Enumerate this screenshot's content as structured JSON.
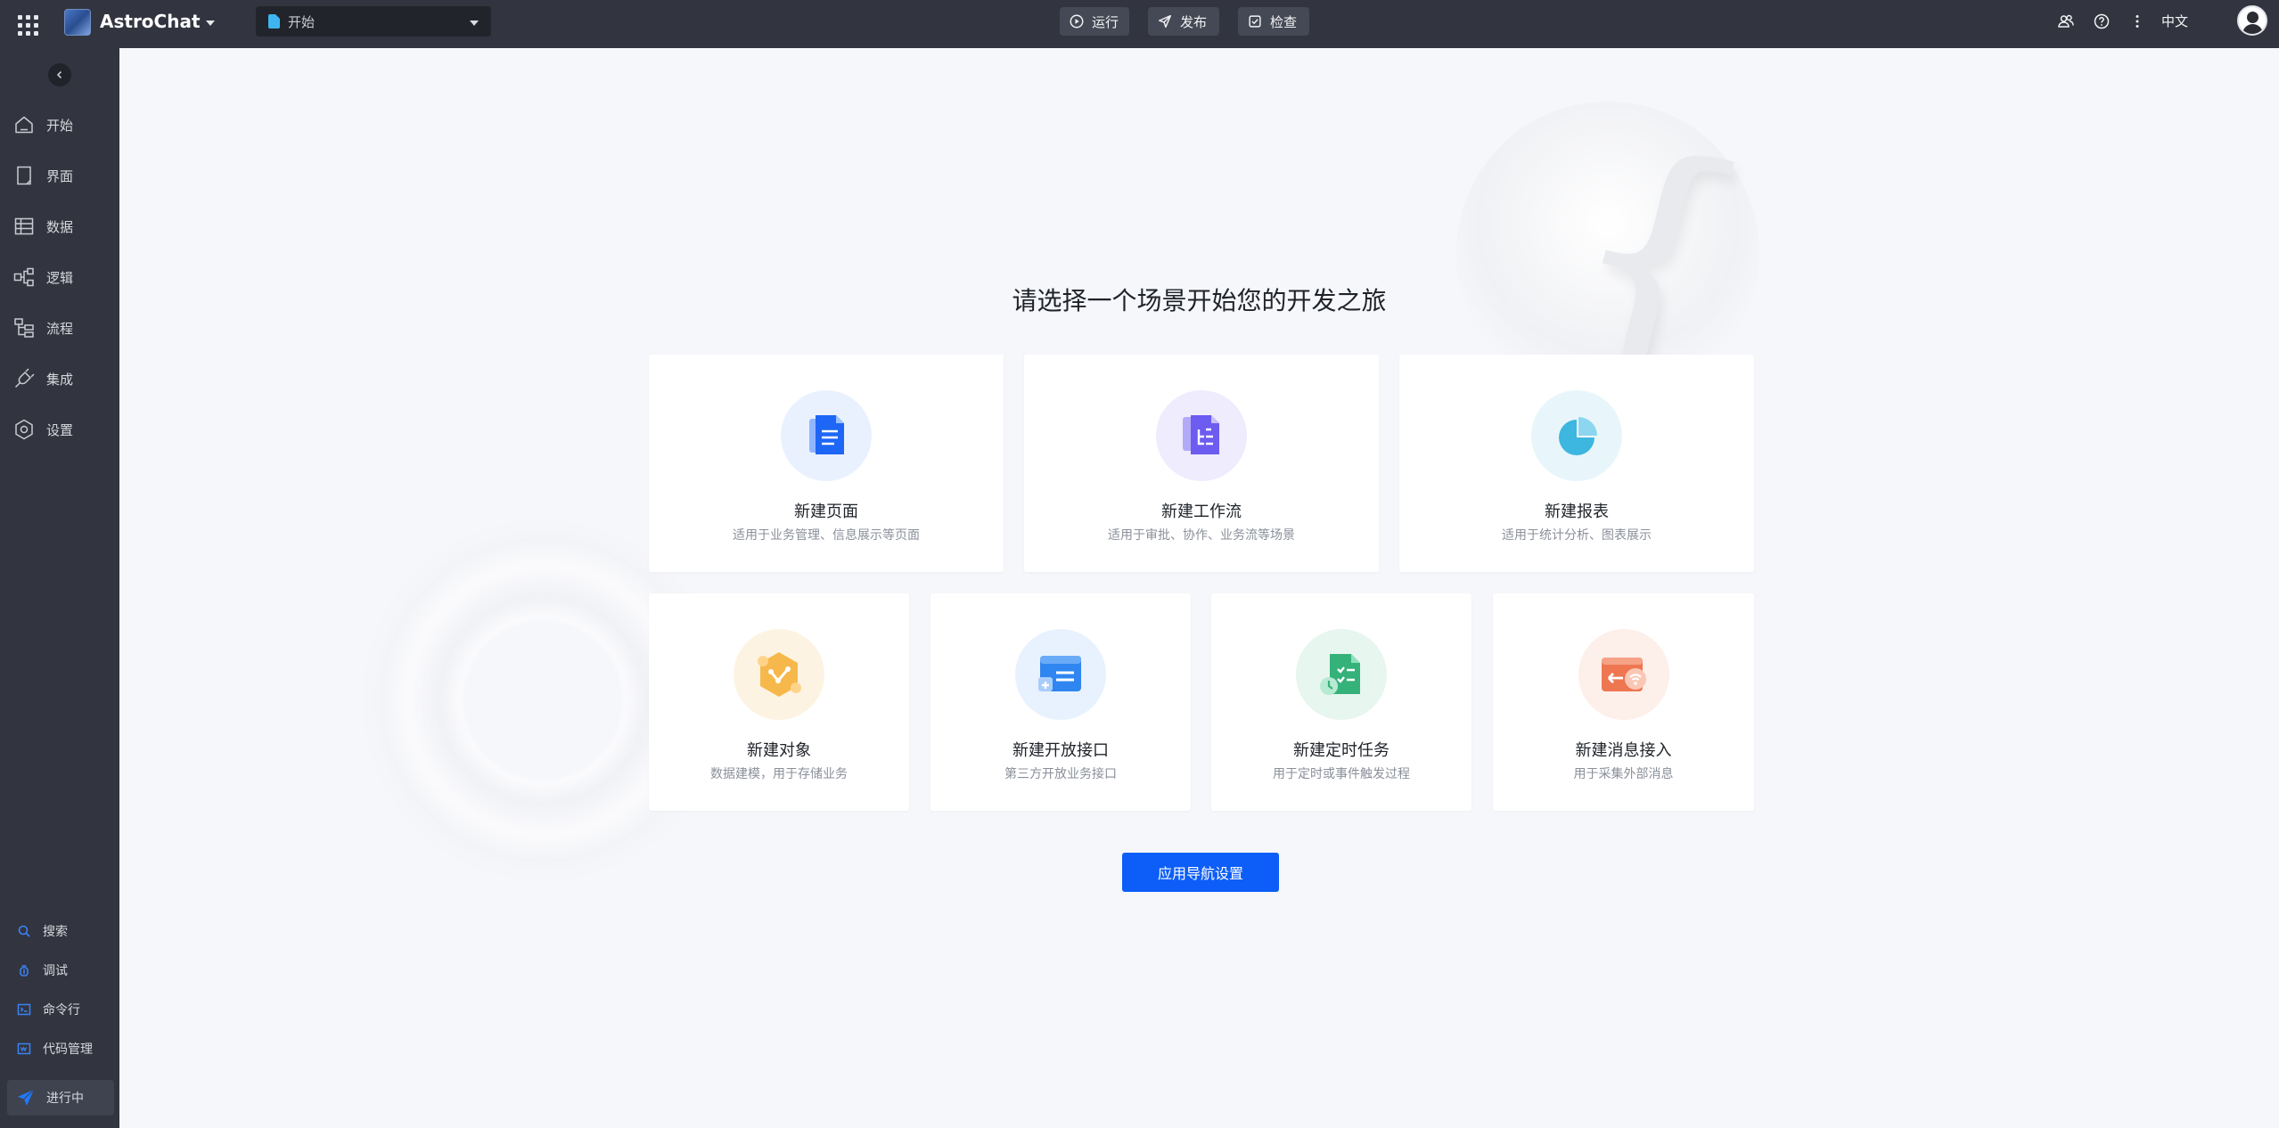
{
  "topbar": {
    "app_name": "AstroChat",
    "page_select": "开始",
    "run_label": "运行",
    "publish_label": "发布",
    "check_label": "检查",
    "language": "中文"
  },
  "sidebar": {
    "items": [
      {
        "label": "开始",
        "icon": "home-icon"
      },
      {
        "label": "界面",
        "icon": "page-icon"
      },
      {
        "label": "数据",
        "icon": "table-icon"
      },
      {
        "label": "逻辑",
        "icon": "logic-icon"
      },
      {
        "label": "流程",
        "icon": "flow-icon"
      },
      {
        "label": "集成",
        "icon": "plug-icon"
      },
      {
        "label": "设置",
        "icon": "settings-icon"
      }
    ],
    "bottom": [
      {
        "label": "搜索",
        "icon": "search-icon"
      },
      {
        "label": "调试",
        "icon": "debug-icon"
      },
      {
        "label": "命令行",
        "icon": "terminal-icon"
      },
      {
        "label": "代码管理",
        "icon": "code-icon"
      }
    ],
    "running_label": "进行中"
  },
  "main": {
    "headline": "请选择一个场景开始您的开发之旅",
    "cards": [
      {
        "title": "新建页面",
        "desc": "适用于业务管理、信息展示等页面",
        "icon": "page-doc-icon"
      },
      {
        "title": "新建工作流",
        "desc": "适用于审批、协作、业务流等场景",
        "icon": "workflow-doc-icon"
      },
      {
        "title": "新建报表",
        "desc": "适用于统计分析、图表展示",
        "icon": "pie-chart-icon"
      },
      {
        "title": "新建对象",
        "desc": "数据建模，用于存储业务",
        "icon": "object-hexagon-icon"
      },
      {
        "title": "新建开放接口",
        "desc": "第三方开放业务接口",
        "icon": "open-api-icon"
      },
      {
        "title": "新建定时任务",
        "desc": "用于定时或事件触发过程",
        "icon": "scheduled-task-icon"
      },
      {
        "title": "新建消息接入",
        "desc": "用于采集外部消息",
        "icon": "message-inbound-icon"
      }
    ],
    "nav_button": "应用导航设置"
  },
  "colors": {
    "topbar_bg": "#32353f",
    "accent": "#0d5ef8",
    "background": "#f6f7fb"
  }
}
